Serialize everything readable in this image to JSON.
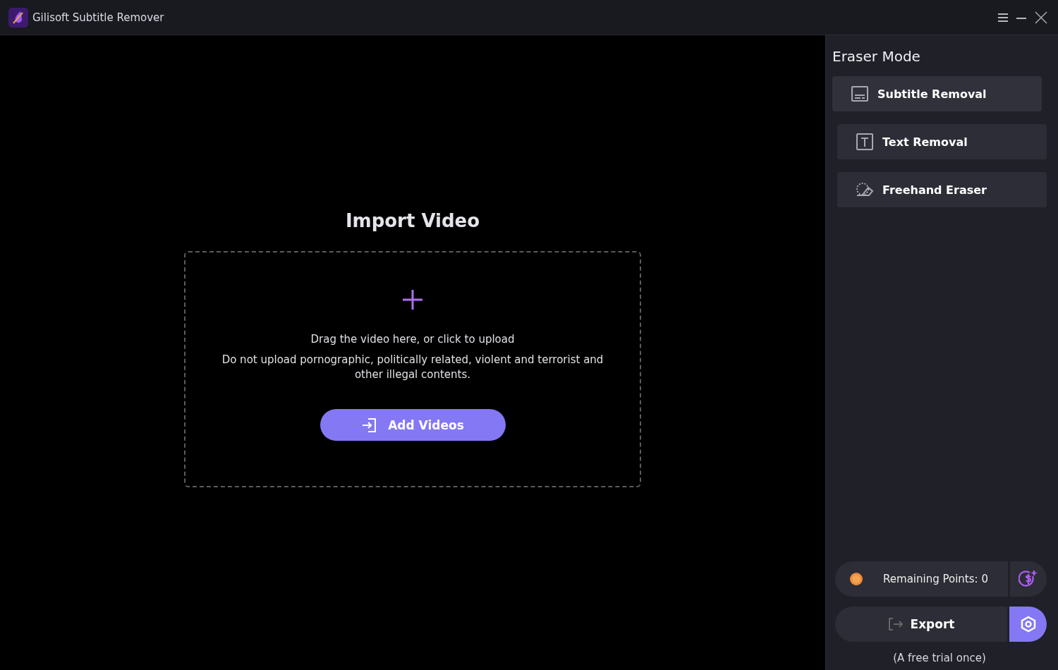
{
  "window": {
    "title": "Gilisoft Subtitle Remover"
  },
  "import": {
    "heading": "Import Video",
    "hint": "Drag the video here, or click to upload",
    "warning": "Do not upload pornographic, politically related, violent and terrorist and other illegal contents.",
    "button": "Add Videos"
  },
  "sidebar": {
    "title": "Eraser Mode",
    "modes": [
      {
        "kind": "subtitle",
        "label": "Subtitle Removal"
      },
      {
        "kind": "text",
        "label": "Text Removal"
      },
      {
        "kind": "freehand",
        "label": "Freehand Eraser"
      }
    ],
    "points": "Remaining Points: 0",
    "export": "Export",
    "note": "(A free trial once)"
  }
}
